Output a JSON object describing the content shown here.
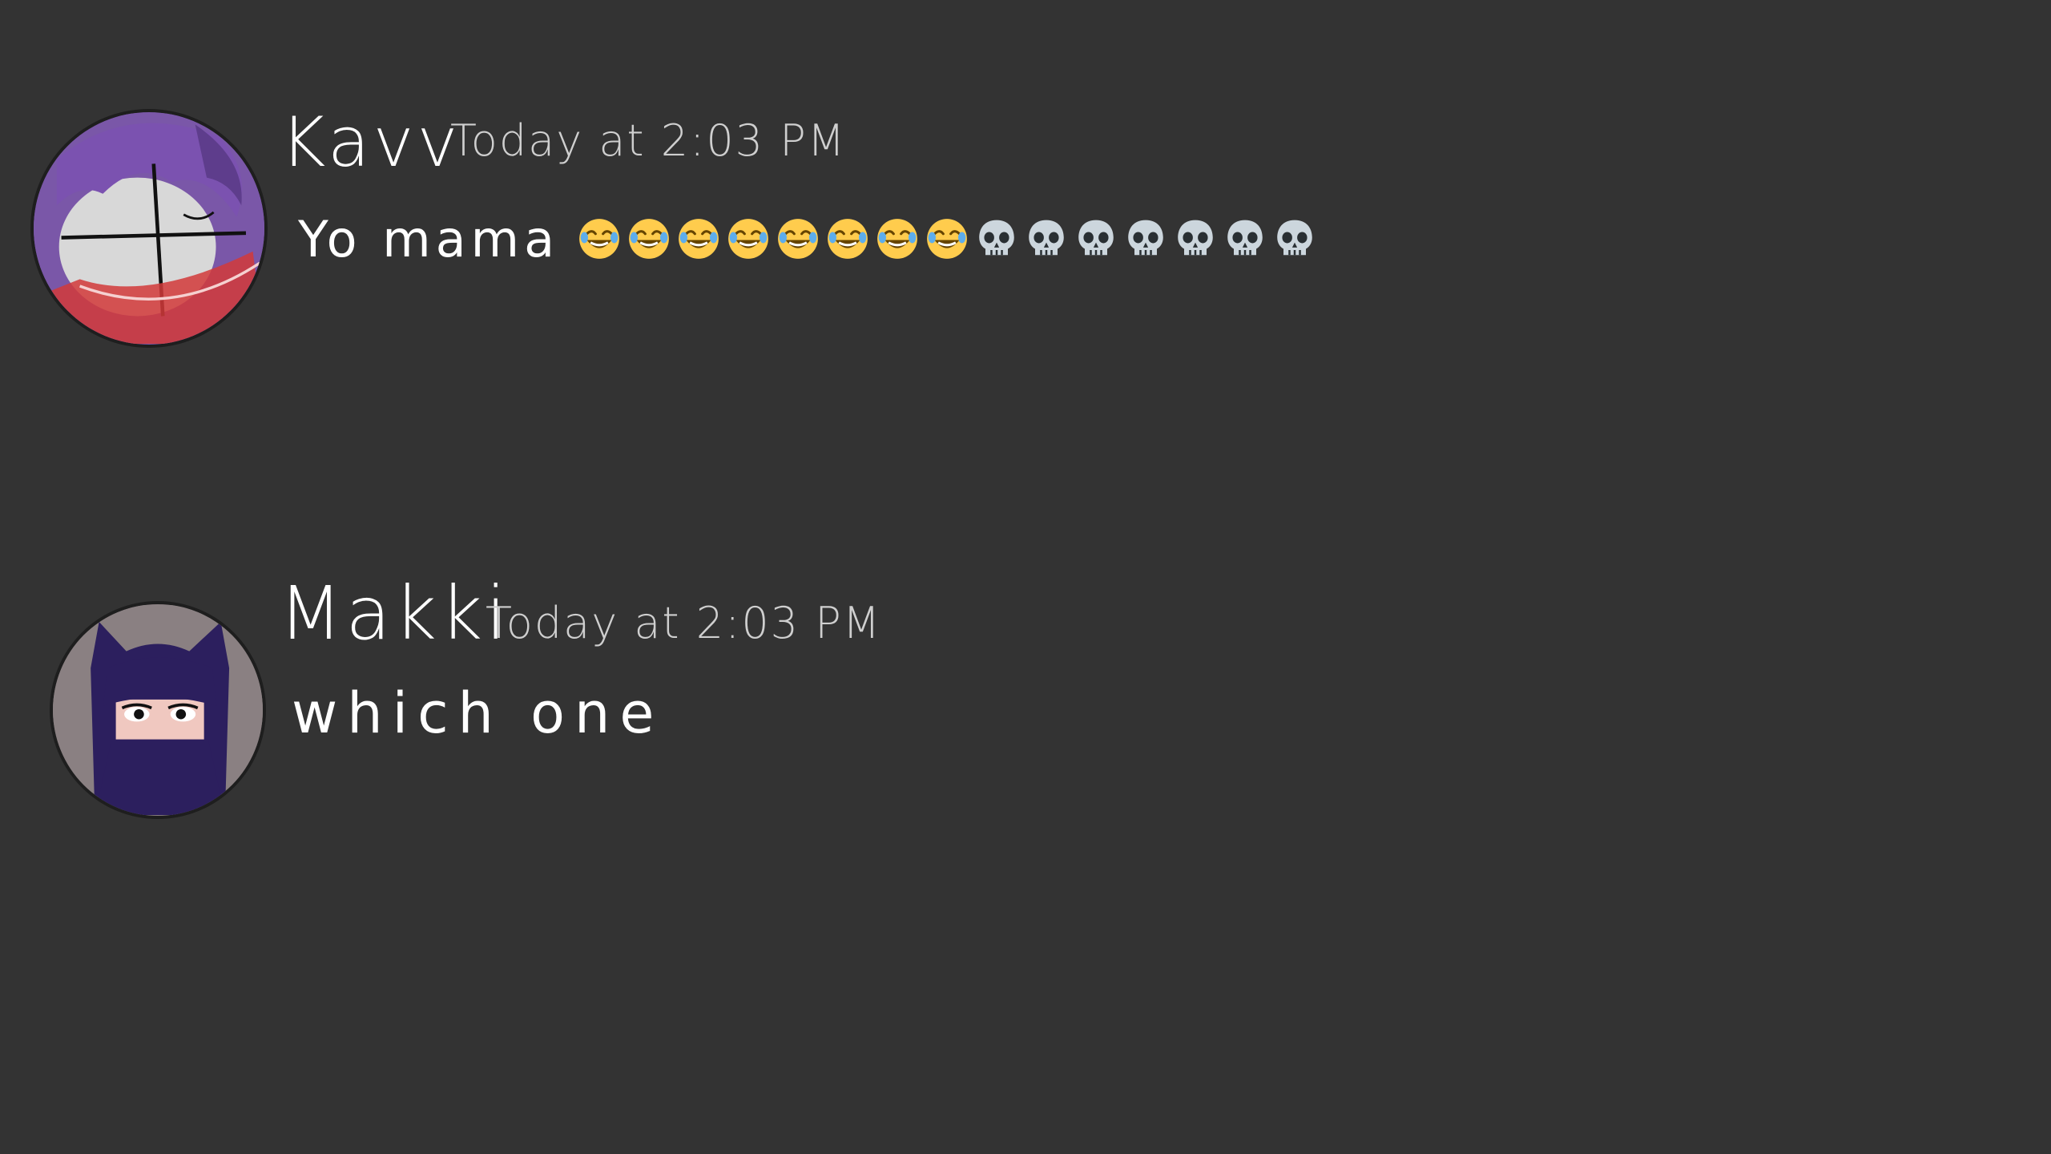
{
  "messages": [
    {
      "username": "Kavv",
      "timestamp": "Today at 2:03 PM",
      "text": "Yo mama",
      "emojis": [
        "joy",
        "joy",
        "joy",
        "joy",
        "joy",
        "joy",
        "joy",
        "joy",
        "skull",
        "skull",
        "skull",
        "skull",
        "skull",
        "skull",
        "skull"
      ],
      "avatar": "avatar-kavv"
    },
    {
      "username": "Makki",
      "timestamp": "Today at 2:03 PM",
      "text": "which one",
      "avatar": "avatar-makki"
    }
  ],
  "colors": {
    "background": "#333333",
    "username": "#ffffff",
    "timestamp": "#cfcfcf",
    "text": "#ffffff"
  }
}
